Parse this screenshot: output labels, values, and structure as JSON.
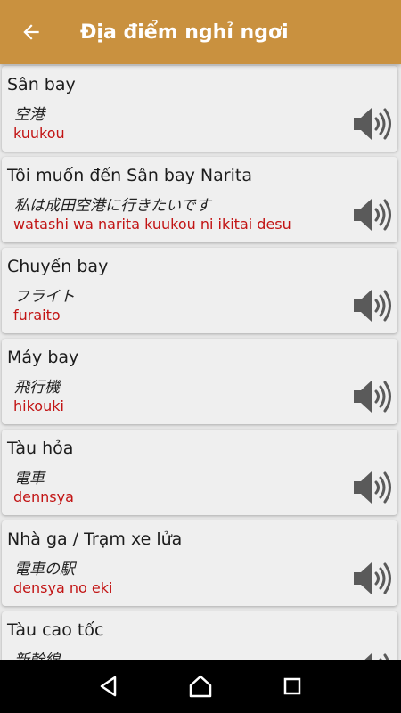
{
  "appbar": {
    "title": "Địa điểm nghỉ ngơi",
    "back_icon": "arrow-left-icon",
    "color": "#c9913f"
  },
  "phrases": [
    {
      "vi": "Sân bay",
      "jp": "空港",
      "romaji": "kuukou"
    },
    {
      "vi": "Tôi muốn đến Sân bay Narita",
      "jp": "私は成田空港に行きたいです",
      "romaji": "watashi wa narita kuukou ni ikitai desu"
    },
    {
      "vi": "Chuyến bay",
      "jp": "フライト",
      "romaji": "furaito"
    },
    {
      "vi": "Máy bay",
      "jp": "飛行機",
      "romaji": "hikouki"
    },
    {
      "vi": "Tàu hỏa",
      "jp": "電車",
      "romaji": "dennsya"
    },
    {
      "vi": "Nhà ga / Trạm xe lửa",
      "jp": "電車の駅",
      "romaji": "densya no eki"
    },
    {
      "vi": "Tàu cao tốc",
      "jp": "新幹線",
      "romaji": ""
    }
  ],
  "speaker_icon": "speaker-icon",
  "navbar": {
    "icons": [
      "back-triangle-icon",
      "home-icon",
      "recents-square-icon"
    ]
  },
  "colors": {
    "romaji": "#c21414",
    "card": "#efefef",
    "background": "#e9e9e9"
  }
}
